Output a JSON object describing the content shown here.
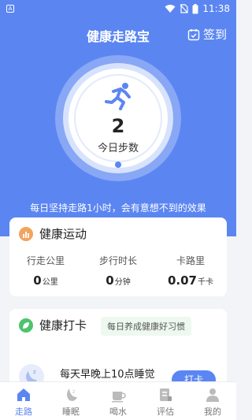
{
  "status_bar": {
    "left_icon": "A",
    "time": "11:38",
    "icons": [
      "wifi-icon",
      "no-sim-icon",
      "battery-icon"
    ]
  },
  "header": {
    "title": "健康走路宝",
    "checkin_label": "签到"
  },
  "steps": {
    "value": "2",
    "label": "今日步数"
  },
  "motto": "每日坚持走路1小时，会有意想不到的效果",
  "sport_card": {
    "title": "健康运动",
    "stats": [
      {
        "label": "行走公里",
        "value": "0",
        "unit": "公里"
      },
      {
        "label": "步行时长",
        "value": "0",
        "unit": "分钟"
      },
      {
        "label": "卡路里",
        "value": "0.07",
        "unit": "千卡"
      }
    ]
  },
  "checkin_card": {
    "title": "健康打卡",
    "tag": "每日养成健康好习惯",
    "task_text": "每天早晚上10点睡觉",
    "task_button": "打卡"
  },
  "tabs": [
    {
      "label": "走路",
      "icon": "home-icon",
      "active": true
    },
    {
      "label": "睡眠",
      "icon": "moon-icon",
      "active": false
    },
    {
      "label": "喝水",
      "icon": "cup-icon",
      "active": false
    },
    {
      "label": "评估",
      "icon": "assessment-icon",
      "active": false
    },
    {
      "label": "我的",
      "icon": "profile-icon",
      "active": false
    }
  ],
  "colors": {
    "primary": "#5b86f2",
    "background": "#f2f4f8",
    "sport_icon": "#f2a45f",
    "checkin_icon": "#4cc46c"
  }
}
